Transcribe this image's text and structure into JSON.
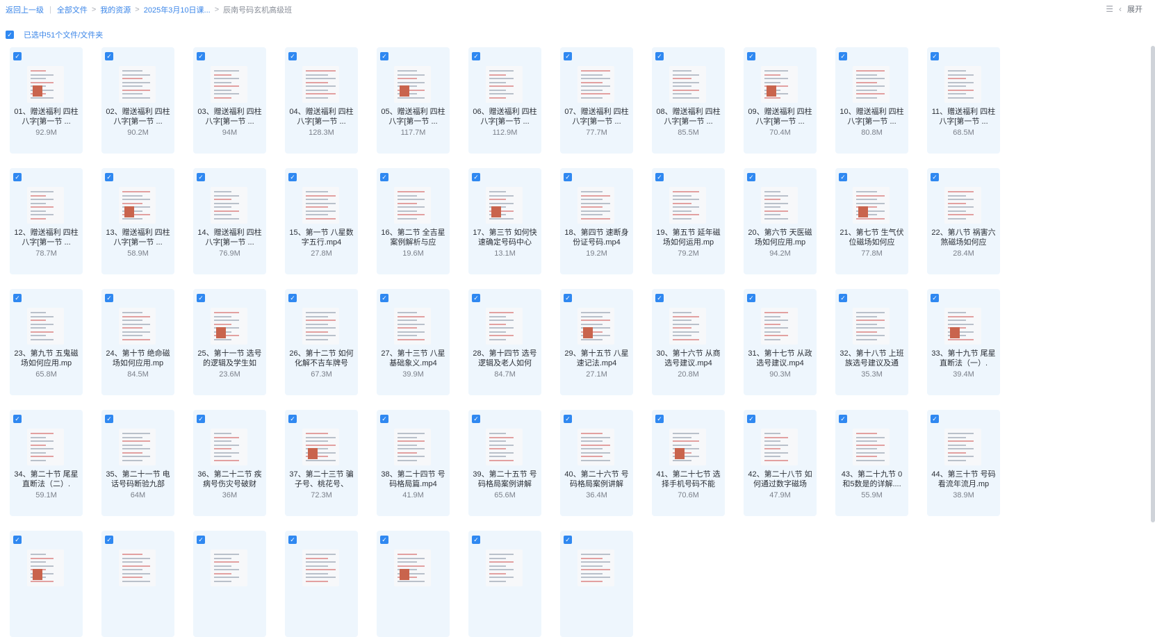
{
  "breadcrumb": {
    "back": "返回上一级",
    "items": [
      "全部文件",
      "我的资源",
      "2025年3月10日课...",
      "辰南号码玄机高级班"
    ]
  },
  "top_right": {
    "expand_label": "展开",
    "list_icon": "list-view-icon",
    "collapse_icon": "chevron-left-icon"
  },
  "selection": {
    "text": "已选中51个文件/文件夹",
    "checkmark": "✓"
  },
  "colors": {
    "accent": "#2f88f1",
    "tile_bg": "#eef6fd"
  },
  "files": [
    {
      "name": "01、赠送福利 四柱八字[第一节 ...",
      "size": "92.9M"
    },
    {
      "name": "02、赠送福利 四柱八字[第一节 ...",
      "size": "90.2M"
    },
    {
      "name": "03、赠送福利 四柱八字[第一节 ...",
      "size": "94M"
    },
    {
      "name": "04、赠送福利 四柱八字[第一节 ...",
      "size": "128.3M"
    },
    {
      "name": "05、赠送福利 四柱八字[第一节 ...",
      "size": "117.7M"
    },
    {
      "name": "06、赠送福利 四柱八字[第一节 ...",
      "size": "112.9M"
    },
    {
      "name": "07、赠送福利 四柱八字[第一节 ...",
      "size": "77.7M"
    },
    {
      "name": "08、赠送福利 四柱八字[第一节 ...",
      "size": "85.5M"
    },
    {
      "name": "09、赠送福利 四柱八字[第一节 ...",
      "size": "70.4M"
    },
    {
      "name": "10、赠送福利 四柱八字[第一节 ...",
      "size": "80.8M"
    },
    {
      "name": "11、赠送福利 四柱八字[第一节 ...",
      "size": "68.5M"
    },
    {
      "name": "12、赠送福利 四柱八字[第一节 ...",
      "size": "78.7M"
    },
    {
      "name": "13、赠送福利 四柱八字[第一节 ...",
      "size": "58.9M"
    },
    {
      "name": "14、赠送福利 四柱八字[第一节 ...",
      "size": "76.9M"
    },
    {
      "name": "15、第一节 八星数字五行.mp4",
      "size": "27.8M"
    },
    {
      "name": "16、第二节 全吉星案例解析与应",
      "size": "19.6M"
    },
    {
      "name": "17、第三节 如何快速确定号码中心",
      "size": "13.1M"
    },
    {
      "name": "18、第四节 速断身份证号码.mp4",
      "size": "19.2M"
    },
    {
      "name": "19、第五节 延年磁场如何运用.mp",
      "size": "79.2M"
    },
    {
      "name": "20、第六节 天医磁场如何应用.mp",
      "size": "94.2M"
    },
    {
      "name": "21、第七节 生气伏位磁场如何应",
      "size": "77.8M"
    },
    {
      "name": "22、第八节 祸害六煞磁场如何应",
      "size": "28.4M"
    },
    {
      "name": "23、第九节 五鬼磁场如何应用.mp",
      "size": "65.8M"
    },
    {
      "name": "24、第十节 绝命磁场如何应用.mp",
      "size": "84.5M"
    },
    {
      "name": "25、第十一节 选号的逻辑及学生如",
      "size": "23.6M"
    },
    {
      "name": "26、第十二节 如何化解不吉车牌号",
      "size": "67.3M"
    },
    {
      "name": "27、第十三节 八星基础象义.mp4",
      "size": "39.9M"
    },
    {
      "name": "28、第十四节 选号逻辑及老人如何",
      "size": "84.7M"
    },
    {
      "name": "29、第十五节 八星速记法.mp4",
      "size": "27.1M"
    },
    {
      "name": "30、第十六节 从商选号建议.mp4",
      "size": "20.8M"
    },
    {
      "name": "31、第十七节 从政选号建议.mp4",
      "size": "90.3M"
    },
    {
      "name": "32、第十八节 上班族选号建议及通",
      "size": "35.3M"
    },
    {
      "name": "33、第十九节 尾星直断法（一）.",
      "size": "39.4M"
    },
    {
      "name": "34、第二十节 尾星直断法（二）.",
      "size": "59.1M"
    },
    {
      "name": "35、第二十一节 电话号码断验九部",
      "size": "64M"
    },
    {
      "name": "36、第二十二节 疾病号伤灾号破财",
      "size": "36M"
    },
    {
      "name": "37、第二十三节 骗子号、桃花号、",
      "size": "72.3M"
    },
    {
      "name": "38、第二十四节 号码格局篇.mp4",
      "size": "41.9M"
    },
    {
      "name": "39、第二十五节 号码格局案例讲解",
      "size": "65.6M"
    },
    {
      "name": "40、第二十六节 号码格局案例讲解",
      "size": "36.4M"
    },
    {
      "name": "41、第二十七节 选择手机号码不能",
      "size": "70.6M"
    },
    {
      "name": "42、第二十八节 如何通过数字磁场",
      "size": "47.9M"
    },
    {
      "name": "43、第二十九节 0和5数是的详解....",
      "size": "55.9M"
    },
    {
      "name": "44、第三十节 号码看流年流月.mp",
      "size": "38.9M"
    },
    {
      "name": "",
      "size": ""
    },
    {
      "name": "",
      "size": ""
    },
    {
      "name": "",
      "size": ""
    },
    {
      "name": "",
      "size": ""
    },
    {
      "name": "",
      "size": ""
    },
    {
      "name": "",
      "size": ""
    },
    {
      "name": "",
      "size": ""
    }
  ]
}
